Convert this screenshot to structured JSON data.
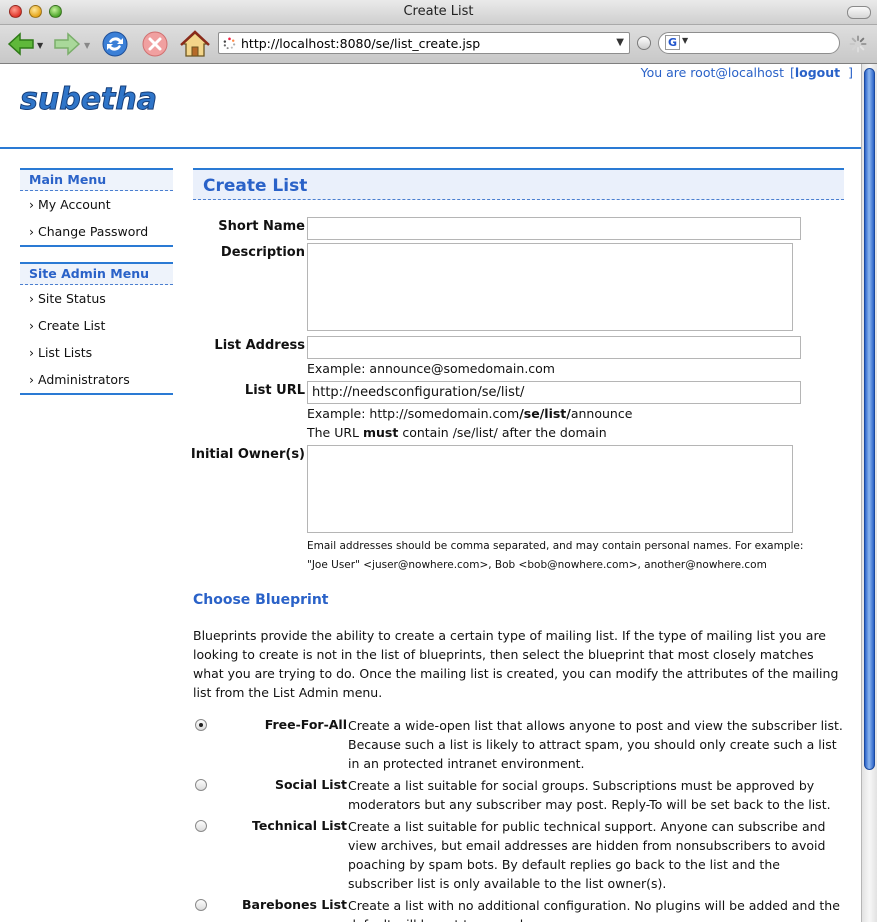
{
  "window": {
    "title": "Create List"
  },
  "browser": {
    "url": "http://localhost:8080/se/list_create.jsp",
    "search_engine_icon": "G"
  },
  "header": {
    "user_prefix": "You are root@localhost",
    "logout_label": "logout",
    "bracket_open": "[",
    "bracket_close": "]"
  },
  "sidebar": {
    "main_menu": {
      "title": "Main Menu",
      "items": [
        {
          "label": "My Account"
        },
        {
          "label": "Change Password"
        }
      ]
    },
    "admin_menu": {
      "title": "Site Admin Menu",
      "items": [
        {
          "label": "Site Status"
        },
        {
          "label": "Create List"
        },
        {
          "label": "List Lists"
        },
        {
          "label": "Administrators"
        }
      ]
    }
  },
  "form": {
    "title": "Create List",
    "short_name_label": "Short Name",
    "short_name_value": "",
    "description_label": "Description",
    "description_value": "",
    "list_address_label": "List Address",
    "list_address_value": "",
    "list_address_hint": "Example: announce@somedomain.com",
    "list_url_label": "List URL",
    "list_url_value": "http://needsconfiguration/se/list/",
    "list_url_hint_prefix": "Example: http://somedomain.com",
    "list_url_hint_bold": "/se/list/",
    "list_url_hint_suffix": "announce",
    "list_url_rule_prefix": "The URL ",
    "list_url_rule_bold": "must",
    "list_url_rule_suffix": " contain /se/list/ after the domain",
    "owners_label": "Initial Owner(s)",
    "owners_value": "",
    "owners_hint_1": "Email addresses should be comma separated, and may contain personal names. For example:",
    "owners_hint_2": "\"Joe User\" <juser@nowhere.com>, Bob <bob@nowhere.com>, another@nowhere.com"
  },
  "blueprint": {
    "heading": "Choose Blueprint",
    "intro": "Blueprints provide the ability to create a certain type of mailing list. If the type of mailing list you are looking to create is not in the list of blueprints, then select the blueprint that most closely matches what you are trying to do. Once the mailing list is created, you can modify the attributes of the mailing list from the List Admin menu.",
    "options": [
      {
        "name": "Free-For-All",
        "checked": true,
        "description": "Create a wide-open list that allows anyone to post and view the subscriber list. Because such a list is likely to attract spam, you should only create such a list in an protected intranet environment."
      },
      {
        "name": "Social List",
        "checked": false,
        "description": "Create a list suitable for social groups. Subscriptions must be approved by moderators but any subscriber may post. Reply-To will be set back to the list."
      },
      {
        "name": "Technical List",
        "checked": false,
        "description": "Create a list suitable for public technical support. Anyone can subscribe and view archives, but email addresses are hidden from nonsubscribers to avoid poaching by spam bots. By default replies go back to the list and the subscriber list is only available to the list owner(s)."
      },
      {
        "name": "Barebones List",
        "checked": false,
        "description": "Create a list with no additional configuration. No plugins will be added and the default will be set to no reply."
      }
    ]
  },
  "colors": {
    "accent": "#2a62c8",
    "rule": "#2a7ad4",
    "menu_bg": "#eef3fb"
  }
}
